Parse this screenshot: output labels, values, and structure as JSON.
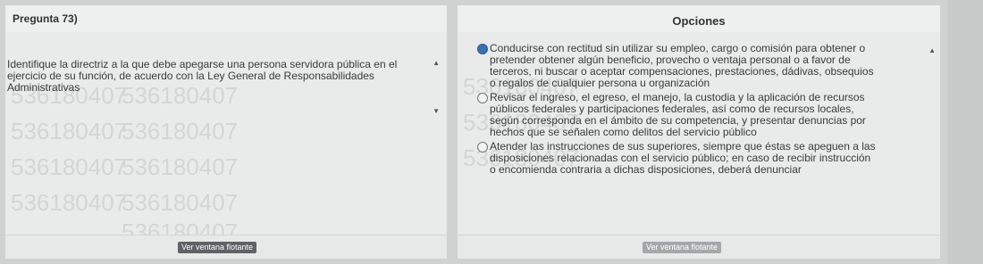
{
  "question_panel": {
    "title": "Pregunta 73)",
    "text": "Identifique la directriz a la que debe apegarse una persona servidora pública en el ejercicio de su función, de acuerdo con la Ley General de Responsabilidades Administrativas",
    "float_button": "Ver ventana flotante",
    "watermark": "536180407"
  },
  "options_panel": {
    "title": "Opciones",
    "options": [
      {
        "text": "Conducirse con rectitud sin utilizar su empleo, cargo o comisión para obtener o pretender obtener algún beneficio, provecho o ventaja personal o a favor de terceros, ni buscar o aceptar compensaciones, prestaciones, dádivas, obsequios o regalos de cualquier persona u organización",
        "selected": true
      },
      {
        "text": "Revisar el ingreso, el egreso, el manejo, la custodia y la aplicación de recursos públicos federales y participaciones federales, así como de recursos locales, según corresponda en el ámbito de su competencia, y presentar denuncias por hechos que se señalen como delitos del servicio público",
        "selected": false
      },
      {
        "text": "Atender las instrucciones de sus superiores, siempre que éstas se apeguen a las disposiciones relacionadas con el servicio público; en caso de recibir instrucción o encomienda contraria a dichas disposiciones, deberá denunciar",
        "selected": false
      }
    ],
    "float_button": "Ver ventana flotante"
  }
}
